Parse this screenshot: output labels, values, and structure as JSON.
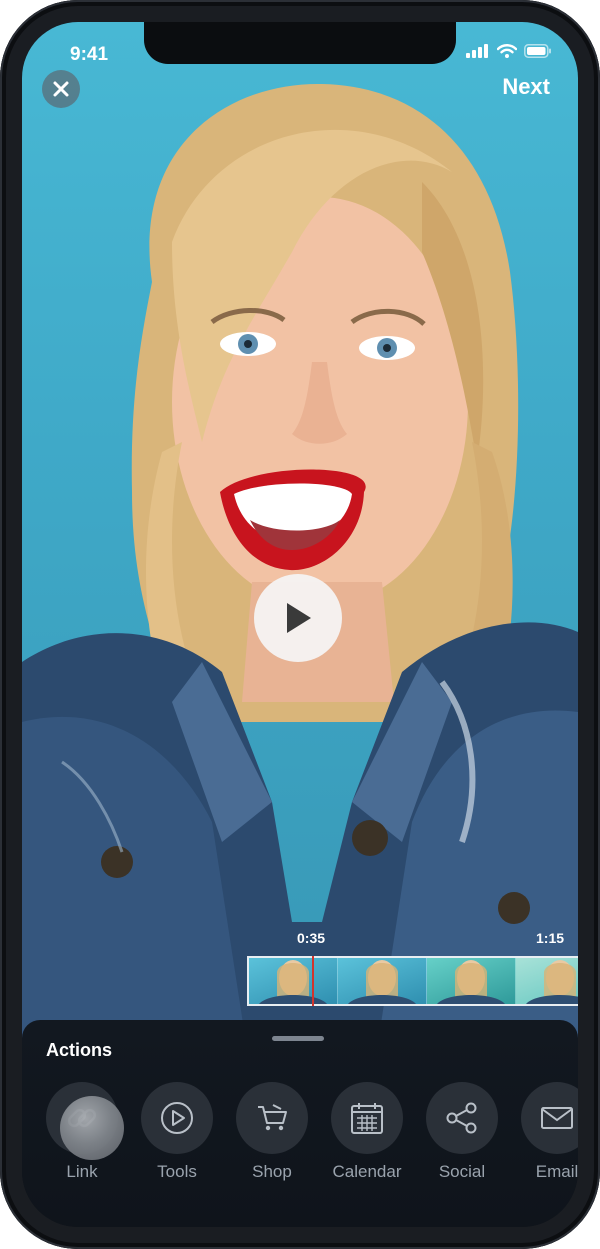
{
  "status_bar": {
    "time": "9:41"
  },
  "header": {
    "close_icon": "close-icon",
    "next_label": "Next"
  },
  "player": {
    "play_icon": "play-icon",
    "current_time": "0:35",
    "end_time": "1:15"
  },
  "sheet": {
    "title": "Actions",
    "actions": [
      {
        "label": "Link",
        "icon": "link-icon"
      },
      {
        "label": "Tools",
        "icon": "play-circle-icon"
      },
      {
        "label": "Shop",
        "icon": "cart-icon"
      },
      {
        "label": "Calendar",
        "icon": "calendar-icon"
      },
      {
        "label": "Social",
        "icon": "share-icon"
      },
      {
        "label": "Email",
        "icon": "mail-icon"
      }
    ]
  },
  "colors": {
    "background_sky": "#48b8d4",
    "sheet_bg": "#121820",
    "playhead": "#d2342c",
    "action_circle": "#2a3038",
    "action_label": "#9aa3ad"
  }
}
